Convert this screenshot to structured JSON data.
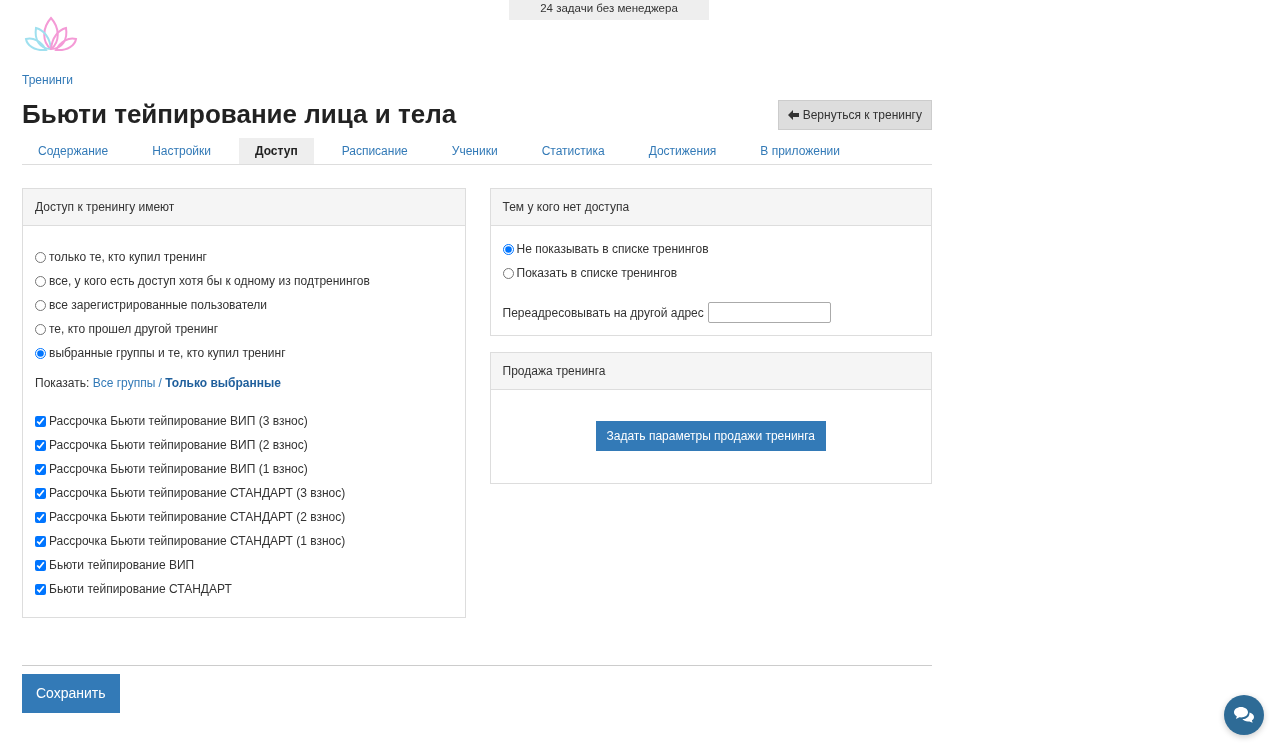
{
  "top_notice": "24 задачи без менеджера",
  "breadcrumb": "Тренинги",
  "title": "Бьюти тейпирование лица и тела",
  "back_button": "Вернуться к тренингу",
  "tabs": [
    {
      "label": "Содержание",
      "selected": false
    },
    {
      "label": "Настройки",
      "selected": false
    },
    {
      "label": "Доступ",
      "selected": true
    },
    {
      "label": "Расписание",
      "selected": false
    },
    {
      "label": "Ученики",
      "selected": false
    },
    {
      "label": "Статистика",
      "selected": false
    },
    {
      "label": "Достижения",
      "selected": false
    },
    {
      "label": "В приложении",
      "selected": false
    }
  ],
  "access_panel": {
    "title": "Доступ к тренингу имеют",
    "options": [
      {
        "label": "только те, кто купил тренинг",
        "selected": false
      },
      {
        "label": "все, у кого есть доступ хотя бы к одному из подтренингов",
        "selected": false
      },
      {
        "label": "все зарегистрированные пользователи",
        "selected": false
      },
      {
        "label": "те, кто прошел другой тренинг",
        "selected": false
      },
      {
        "label": "выбранные группы и те, кто купил тренинг",
        "selected": true
      }
    ],
    "show_filter": {
      "label": "Показать:",
      "separator": "/",
      "options": [
        {
          "label": "Все группы",
          "selected": false
        },
        {
          "label": "Только выбранные",
          "selected": true
        }
      ]
    },
    "groups": [
      {
        "label": "Рассрочка Бьюти тейпирование ВИП (3 взнос)",
        "checked": true
      },
      {
        "label": "Рассрочка Бьюти тейпирование ВИП (2 взнос)",
        "checked": true
      },
      {
        "label": "Рассрочка Бьюти тейпирование ВИП (1 взнос)",
        "checked": true
      },
      {
        "label": "Рассрочка Бьюти тейпирование СТАНДАРТ (3 взнос)",
        "checked": true
      },
      {
        "label": "Рассрочка Бьюти тейпирование СТАНДАРТ (2 взнос)",
        "checked": true
      },
      {
        "label": "Рассрочка Бьюти тейпирование СТАНДАРТ (1 взнос)",
        "checked": true
      },
      {
        "label": "Бьюти тейпирование ВИП",
        "checked": true
      },
      {
        "label": "Бьюти тейпирование СТАНДАРТ",
        "checked": true
      }
    ]
  },
  "no_access_panel": {
    "title": "Тем у кого нет доступа",
    "options": [
      {
        "label": "Не показывать в списке тренингов",
        "selected": true
      },
      {
        "label": "Показать в списке тренингов",
        "selected": false
      }
    ],
    "redirect_label": "Переадресовывать на другой адрес"
  },
  "sale_panel": {
    "title": "Продажа тренинга",
    "button": "Задать параметры продажи тренинга"
  },
  "save_button": "Сохранить"
}
